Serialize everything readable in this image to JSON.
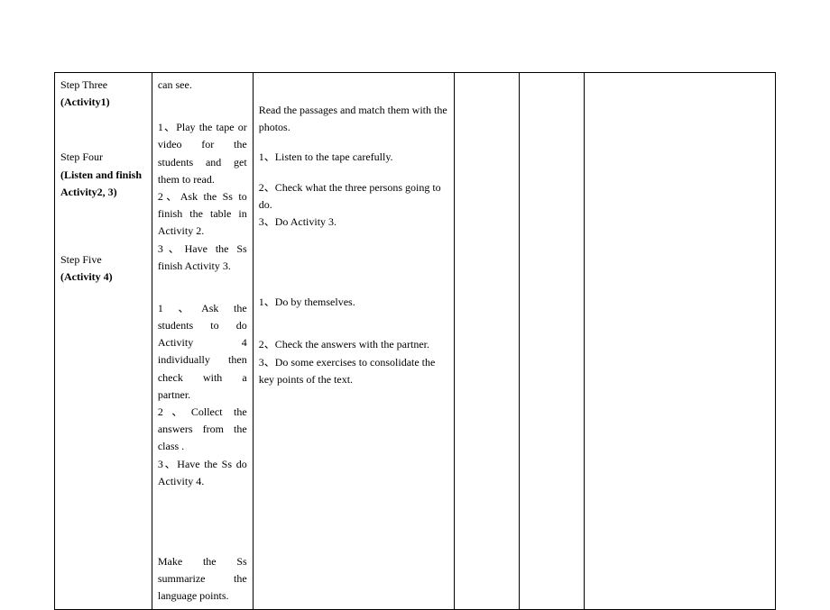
{
  "row": {
    "col1": {
      "step3_line1": "Step Three",
      "step3_line2": "(Activity1)",
      "step4_line1": "Step Four",
      "step4_line2": "(Listen and finish",
      "step4_line3": "Activity2, 3)",
      "step5_line1": "Step Five",
      "step5_line2": "(Activity 4)"
    },
    "col2": {
      "cansee": "can see.",
      "block_a1": "1、Play the tape or video for the students and get them to read.",
      "block_a2": "2、Ask the Ss to finish  the table in Activity 2.",
      "block_a3": "3、Have the Ss finish Activity 3.",
      "block_b1": "1 、Ask the students to do Activity 4 individually then check with a partner.",
      "block_b2": "2、Collect the answers from the class .",
      "block_b3": "3、Have the Ss do Activity 4.",
      "summary": "Make the Ss summarize the language points."
    },
    "col3": {
      "read_passage": "Read the passages and match them with the photos.",
      "c1": "1、Listen to the tape carefully.",
      "c2": "2、Check what the three persons going to do.",
      "c3": "3、Do Activity 3.",
      "d1": "1、Do by themselves.",
      "d2": "2、Check the answers with the partner.",
      "d3": "3、Do some exercises to consolidate the key points of the text."
    }
  }
}
